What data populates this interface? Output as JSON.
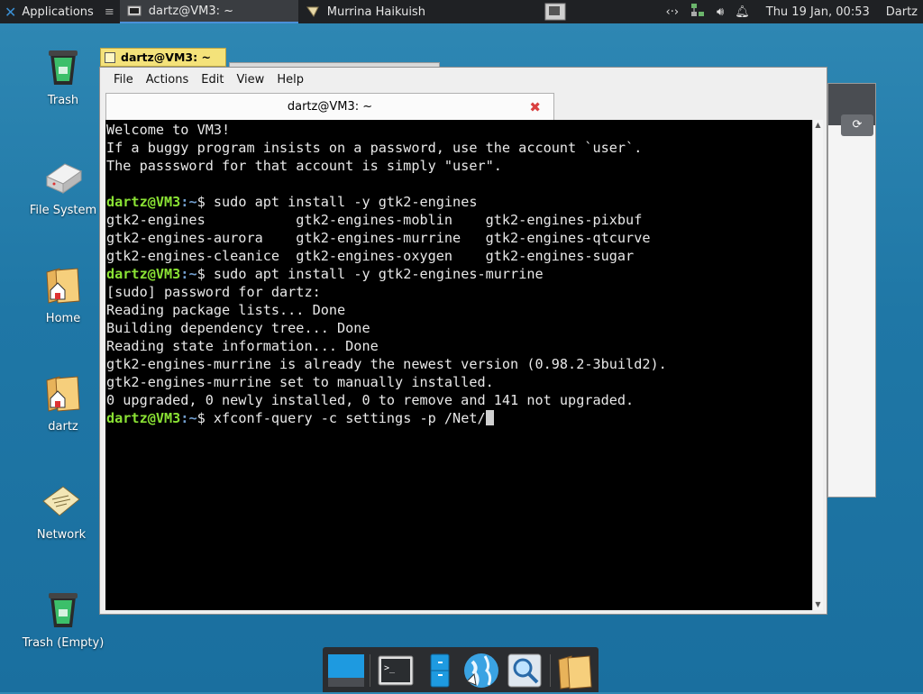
{
  "top_panel": {
    "applications_label": "Applications",
    "tasks": [
      {
        "label": "dartz@VM3: ~",
        "active": true,
        "icon": "terminal-icon"
      },
      {
        "label": "Murrina Haikuish",
        "active": false,
        "icon": "theme-icon"
      }
    ],
    "clock": "Thu 19 Jan, 00:53",
    "user": "Dartz"
  },
  "desktop_icons": [
    {
      "label": "Trash",
      "icon": "trash-icon"
    },
    {
      "label": "File System",
      "icon": "drive-icon"
    },
    {
      "label": "Home",
      "icon": "home-folder-icon"
    },
    {
      "label": "dartz",
      "icon": "folder-icon"
    },
    {
      "label": "Network",
      "icon": "network-icon"
    },
    {
      "label": "Trash (Empty)",
      "icon": "trash-empty-icon"
    }
  ],
  "terminal": {
    "window_title": "dartz@VM3: ~",
    "menu": [
      "File",
      "Actions",
      "Edit",
      "View",
      "Help"
    ],
    "tab_title": "dartz@VM3: ~",
    "prompt_user": "dartz@VM3",
    "prompt_path": ":~",
    "prompt_symbol": "$ ",
    "lines": [
      {
        "text": "Welcome to VM3!"
      },
      {
        "text": "If a buggy program insists on a password, use the account `user`."
      },
      {
        "text": "The passsword for that account is simply \"user\"."
      },
      {
        "text": ""
      },
      {
        "prompt": true,
        "text": "sudo apt install -y gtk2-engines"
      },
      {
        "text": "gtk2-engines           gtk2-engines-moblin    gtk2-engines-pixbuf"
      },
      {
        "text": "gtk2-engines-aurora    gtk2-engines-murrine   gtk2-engines-qtcurve"
      },
      {
        "text": "gtk2-engines-cleanice  gtk2-engines-oxygen    gtk2-engines-sugar"
      },
      {
        "prompt": true,
        "text": "sudo apt install -y gtk2-engines-murrine"
      },
      {
        "text": "[sudo] password for dartz:"
      },
      {
        "text": "Reading package lists... Done"
      },
      {
        "text": "Building dependency tree... Done"
      },
      {
        "text": "Reading state information... Done"
      },
      {
        "text": "gtk2-engines-murrine is already the newest version (0.98.2-3build2)."
      },
      {
        "text": "gtk2-engines-murrine set to manually installed."
      },
      {
        "text": "0 upgraded, 0 newly installed, 0 to remove and 141 not upgraded."
      },
      {
        "prompt": true,
        "text": "xfconf-query -c settings -p /Net/",
        "cursor": true
      }
    ]
  },
  "dock_items": [
    "show-desktop-icon",
    "terminal-icon",
    "file-manager-icon",
    "web-browser-icon",
    "app-finder-icon",
    "folder-icon"
  ],
  "colors": {
    "desktop": "#1f77a6",
    "prompt_user": "#8ae234",
    "prompt_path": "#729fcf",
    "terminal_bg": "#000000"
  }
}
